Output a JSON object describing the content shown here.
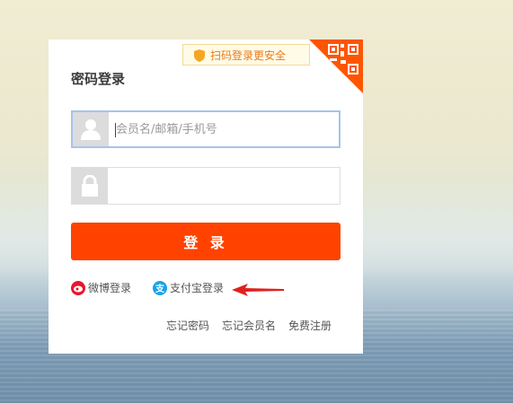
{
  "panel": {
    "qr_hint": "扫码登录更安全",
    "title": "密码登录",
    "username": {
      "placeholder": "会员名/邮箱/手机号",
      "value": ""
    },
    "password": {
      "value": ""
    },
    "login_button": "登 录",
    "social": [
      {
        "label": "微博登录",
        "icon": "weibo-icon",
        "color": "#e6162d"
      },
      {
        "label": "支付宝登录",
        "icon": "alipay-icon",
        "color": "#1aa3e8"
      }
    ],
    "links": [
      "忘记密码",
      "忘记会员名",
      "免费注册"
    ]
  },
  "colors": {
    "accent": "#ff4200",
    "qr": "#ff5500",
    "arrow": "#e02020"
  }
}
